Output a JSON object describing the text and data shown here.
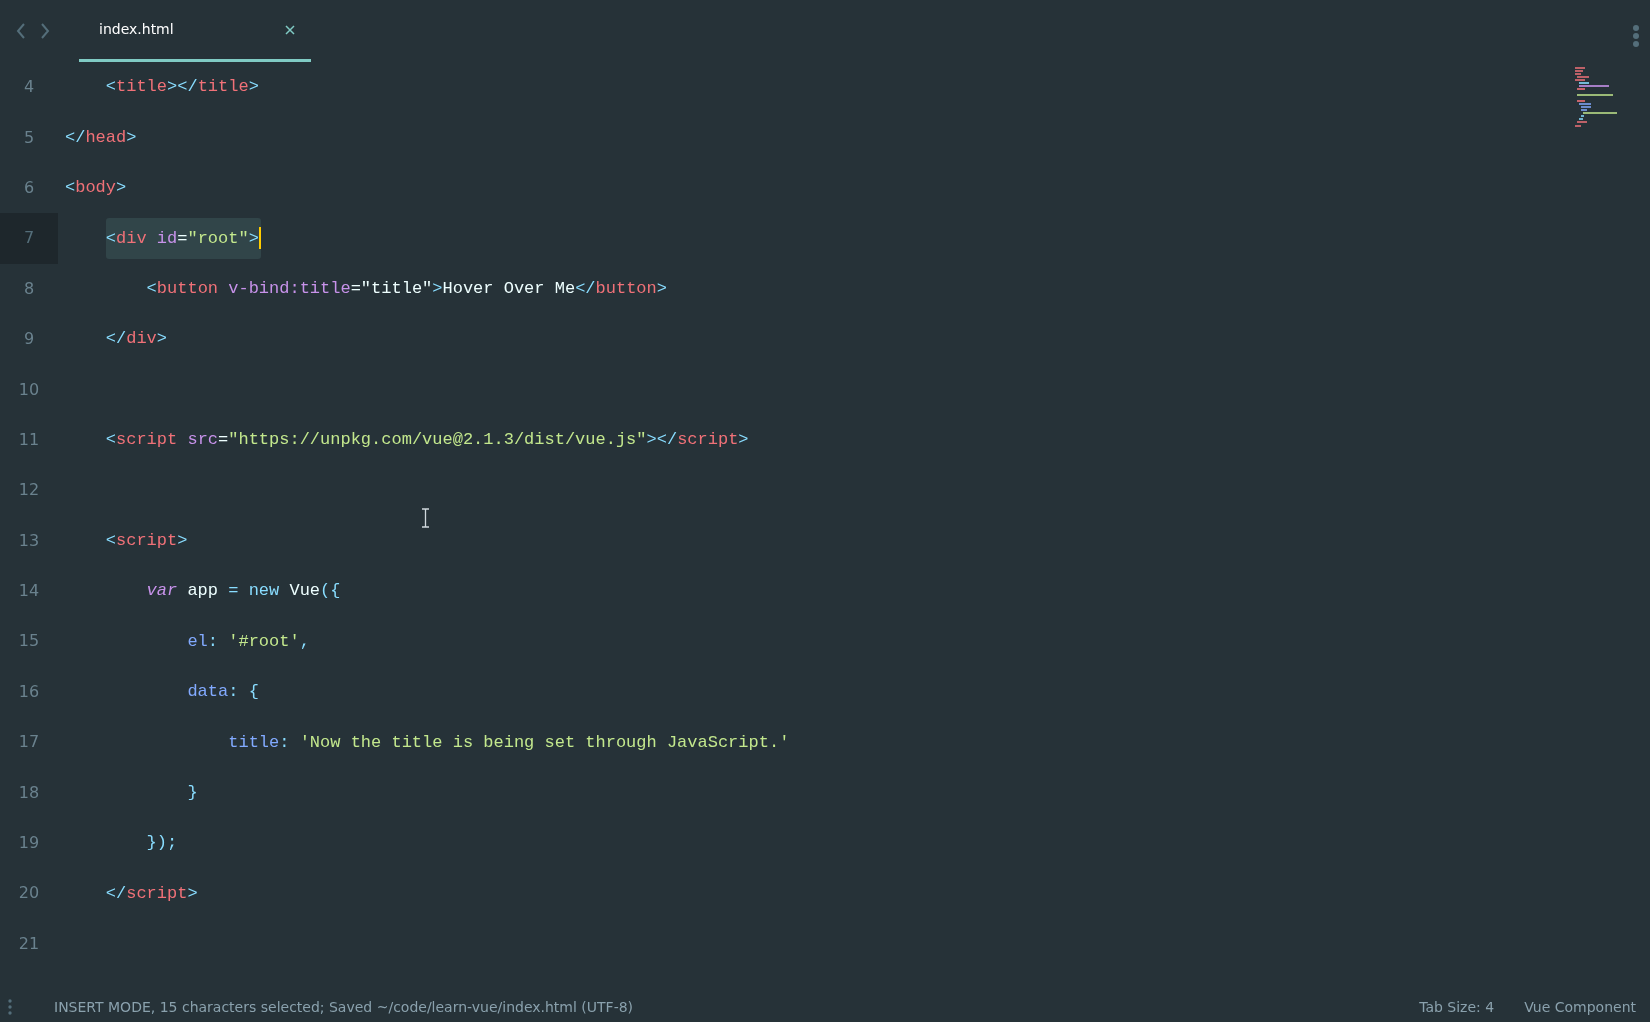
{
  "tab": {
    "label": "index.html",
    "selected": true
  },
  "lines": [
    {
      "number": "4",
      "current": false,
      "tokens": [
        {
          "kind": "bracket",
          "text": "    <"
        },
        {
          "kind": "tag",
          "text": "title"
        },
        {
          "kind": "bracket",
          "text": "></"
        },
        {
          "kind": "tag",
          "text": "title"
        },
        {
          "kind": "bracket",
          "text": ">"
        }
      ]
    },
    {
      "number": "5",
      "current": false,
      "tokens": [
        {
          "kind": "bracket",
          "text": "</"
        },
        {
          "kind": "tag",
          "text": "head"
        },
        {
          "kind": "bracket",
          "text": ">"
        }
      ]
    },
    {
      "number": "6",
      "current": false,
      "tokens": [
        {
          "kind": "bracket",
          "text": "<"
        },
        {
          "kind": "tag",
          "text": "body"
        },
        {
          "kind": "bracket",
          "text": ">"
        }
      ]
    },
    {
      "number": "7",
      "current": true,
      "tokens": [
        {
          "kind": "bracket",
          "text": "    <"
        },
        {
          "kind": "tag",
          "text": "div"
        },
        {
          "kind": "attr",
          "text": " id"
        },
        {
          "kind": "text",
          "text": "="
        },
        {
          "kind": "string",
          "text": "\"root\""
        },
        {
          "kind": "bracket",
          "text": ">"
        }
      ]
    },
    {
      "number": "8",
      "current": false,
      "tokens": [
        {
          "kind": "bracket",
          "text": "        <"
        },
        {
          "kind": "tag",
          "text": "button"
        },
        {
          "kind": "attr",
          "text": " v-bind:title"
        },
        {
          "kind": "text",
          "text": "=\"title\""
        },
        {
          "kind": "bracket",
          "text": ">"
        },
        {
          "kind": "text",
          "text": "Hover Over Me"
        },
        {
          "kind": "bracket",
          "text": "</"
        },
        {
          "kind": "tag",
          "text": "button"
        },
        {
          "kind": "bracket",
          "text": ">"
        }
      ]
    },
    {
      "number": "9",
      "current": false,
      "tokens": [
        {
          "kind": "bracket",
          "text": "    </"
        },
        {
          "kind": "tag",
          "text": "div"
        },
        {
          "kind": "bracket",
          "text": ">"
        }
      ]
    },
    {
      "number": "10",
      "current": false
    },
    {
      "number": "11",
      "current": false,
      "tokens": [
        {
          "kind": "bracket",
          "text": "    <"
        },
        {
          "kind": "tag",
          "text": "script"
        },
        {
          "kind": "attr",
          "text": " src"
        },
        {
          "kind": "text",
          "text": "="
        },
        {
          "kind": "string",
          "text": "\"https://unpkg.com/vue@2.1.3/dist/vue.js\""
        },
        {
          "kind": "bracket",
          "text": "></"
        },
        {
          "kind": "tag",
          "text": "script"
        },
        {
          "kind": "bracket",
          "text": ">"
        }
      ]
    },
    {
      "number": "12",
      "current": false
    },
    {
      "number": "13",
      "current": false,
      "tokens": [
        {
          "kind": "bracket",
          "text": "    <"
        },
        {
          "kind": "tag",
          "text": "script"
        },
        {
          "kind": "bracket",
          "text": ">"
        }
      ]
    },
    {
      "number": "14",
      "current": false,
      "tokens": [
        {
          "kind": "keyword",
          "text": "        var"
        },
        {
          "kind": "text",
          "text": " app "
        },
        {
          "kind": "bracket",
          "text": "= new"
        },
        {
          "kind": "text",
          "text": " Vue"
        },
        {
          "kind": "bracket",
          "text": "({"
        }
      ]
    },
    {
      "number": "15",
      "current": false,
      "tokens": [
        {
          "kind": "prop",
          "text": "            el"
        },
        {
          "kind": "bracket",
          "text": ":"
        },
        {
          "kind": "string",
          "text": " '#root'"
        },
        {
          "kind": "bracket",
          "text": ","
        }
      ]
    },
    {
      "number": "16",
      "current": false,
      "tokens": [
        {
          "kind": "prop",
          "text": "            data"
        },
        {
          "kind": "bracket",
          "text": ": {"
        }
      ]
    },
    {
      "number": "17",
      "current": false,
      "tokens": [
        {
          "kind": "prop",
          "text": "                title"
        },
        {
          "kind": "bracket",
          "text": ":"
        },
        {
          "kind": "string",
          "text": " 'Now the title is being set through JavaScript.'"
        }
      ]
    },
    {
      "number": "18",
      "current": false,
      "tokens": [
        {
          "kind": "bracket",
          "text": "            }"
        }
      ]
    },
    {
      "number": "19",
      "current": false,
      "tokens": [
        {
          "kind": "bracket",
          "text": "        });"
        }
      ]
    },
    {
      "number": "20",
      "current": false,
      "tokens": [
        {
          "kind": "bracket",
          "text": "    </"
        },
        {
          "kind": "tag",
          "text": "script"
        },
        {
          "kind": "bracket",
          "text": ">"
        }
      ]
    },
    {
      "number": "21",
      "current": false
    }
  ],
  "status_bar": {
    "message": "INSERT MODE, 15 characters selected; Saved ~/code/learn-vue/index.html (UTF-8)",
    "tab_size": "Tab Size: 4",
    "syntax": "Vue Component"
  }
}
